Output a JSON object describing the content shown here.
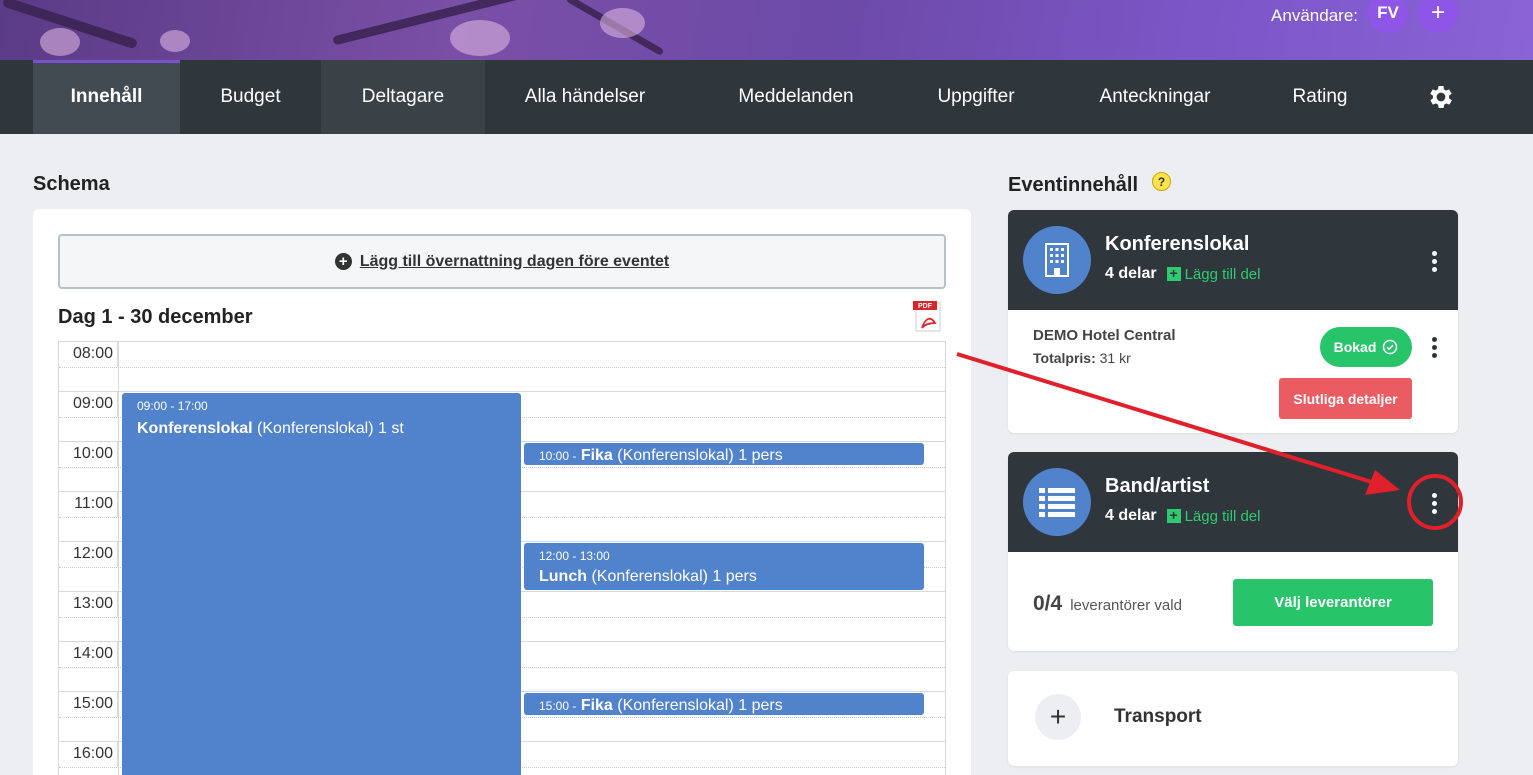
{
  "header": {
    "user_label": "Användare:",
    "user_initials": "FV",
    "add_user_symbol": "+"
  },
  "nav": {
    "items": [
      {
        "label": "Innehåll",
        "active": true
      },
      {
        "label": "Budget"
      },
      {
        "label": "Deltagare"
      },
      {
        "label": "Alla händelser"
      },
      {
        "label": "Meddelanden"
      },
      {
        "label": "Uppgifter"
      },
      {
        "label": "Anteckningar"
      },
      {
        "label": "Rating"
      }
    ],
    "settings_icon": "gear-icon"
  },
  "schema": {
    "title": "Schema",
    "overnight_button": "Lägg till övernattning dagen före eventet",
    "day_title": "Dag 1 - 30 december",
    "pdf_icon": "pdf-icon",
    "pdf_label": "PDF",
    "hours": [
      "08:00",
      "09:00",
      "10:00",
      "11:00",
      "12:00",
      "13:00",
      "14:00",
      "15:00",
      "16:00"
    ],
    "events": [
      {
        "time": "09:00 - 17:00",
        "name": "Konferenslokal",
        "detail": "(Konferenslokal) 1 st"
      },
      {
        "time": "10:00 -",
        "name": "Fika",
        "detail": "(Konferenslokal) 1 pers"
      },
      {
        "time": "12:00 - 13:00",
        "name": "Lunch",
        "detail": "(Konferenslokal) 1 pers"
      },
      {
        "time": "15:00 -",
        "name": "Fika",
        "detail": "(Konferenslokal) 1 pers"
      }
    ]
  },
  "event_content": {
    "title": "Eventinnehåll",
    "help_symbol": "?",
    "cards": [
      {
        "name": "Konferenslokal",
        "parts": "4 delar",
        "add_part": "Lägg till del",
        "icon": "building-icon",
        "hotel_name": "DEMO Hotel Central",
        "total_label": "Totalpris:",
        "total_value": "31 kr",
        "booked_label": "Bokad",
        "final_details_label": "Slutliga detaljer"
      },
      {
        "name": "Band/artist",
        "parts": "4 delar",
        "add_part": "Lägg till del",
        "icon": "list-icon",
        "suppliers_count": "0/4",
        "suppliers_label": "leverantörer vald",
        "choose_button": "Välj leverantörer"
      },
      {
        "name": "Transport",
        "add_symbol": "+"
      }
    ]
  },
  "colors": {
    "nav_bg": "#2f363c",
    "accent_blue": "#5182cc",
    "green": "#27c46a",
    "red": "#ea5b62",
    "annotation": "#e0202a"
  }
}
